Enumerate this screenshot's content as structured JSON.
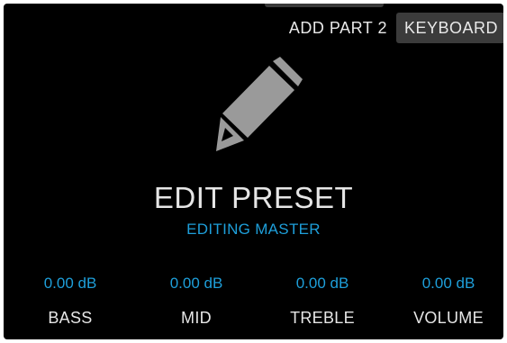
{
  "topbar": {
    "add_part_label": "ADD PART 2",
    "keyboard_label": "KEYBOARD"
  },
  "main": {
    "icon": "pencil-icon",
    "title": "EDIT PRESET",
    "subtitle": "EDITING MASTER"
  },
  "knobs": [
    {
      "label": "BASS",
      "value": "0.00 dB"
    },
    {
      "label": "MID",
      "value": "0.00 dB"
    },
    {
      "label": "TREBLE",
      "value": "0.00 dB"
    },
    {
      "label": "VOLUME",
      "value": "0.00 dB"
    }
  ],
  "colors": {
    "background": "#000000",
    "accent": "#1e9fda",
    "text": "#e6e6e6",
    "button_bg": "#3b3b3b",
    "icon": "#9a9a9a"
  }
}
